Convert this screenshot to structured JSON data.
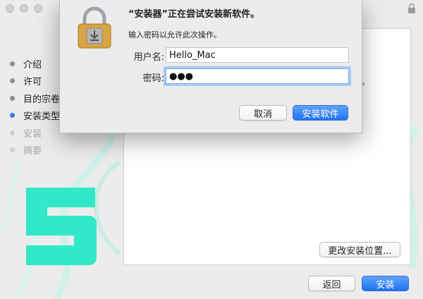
{
  "installer": {
    "steps": [
      {
        "label": "介绍",
        "state": "done"
      },
      {
        "label": "许可",
        "state": "done"
      },
      {
        "label": "目的宗卷",
        "state": "done"
      },
      {
        "label": "安装类型",
        "state": "active"
      },
      {
        "label": "安装",
        "state": "pending"
      },
      {
        "label": "摘要",
        "state": "pending"
      }
    ],
    "change_location_label": "更改安装位置...",
    "back_label": "返回",
    "install_label": "安装",
    "panel_trailing_text": "。"
  },
  "dialog": {
    "title": "“安装器”正在尝试安装新软件。",
    "subtitle": "输入密码以允许此次操作。",
    "username_label": "用户名:",
    "username_value": "Hello_Mac",
    "password_label": "密码:",
    "password_value": "●●●",
    "cancel_label": "取消",
    "install_software_label": "安装软件"
  },
  "colors": {
    "accent": "#3478f6",
    "logo_teal": "#33e8c8",
    "lock_gold": "#d9a441"
  }
}
